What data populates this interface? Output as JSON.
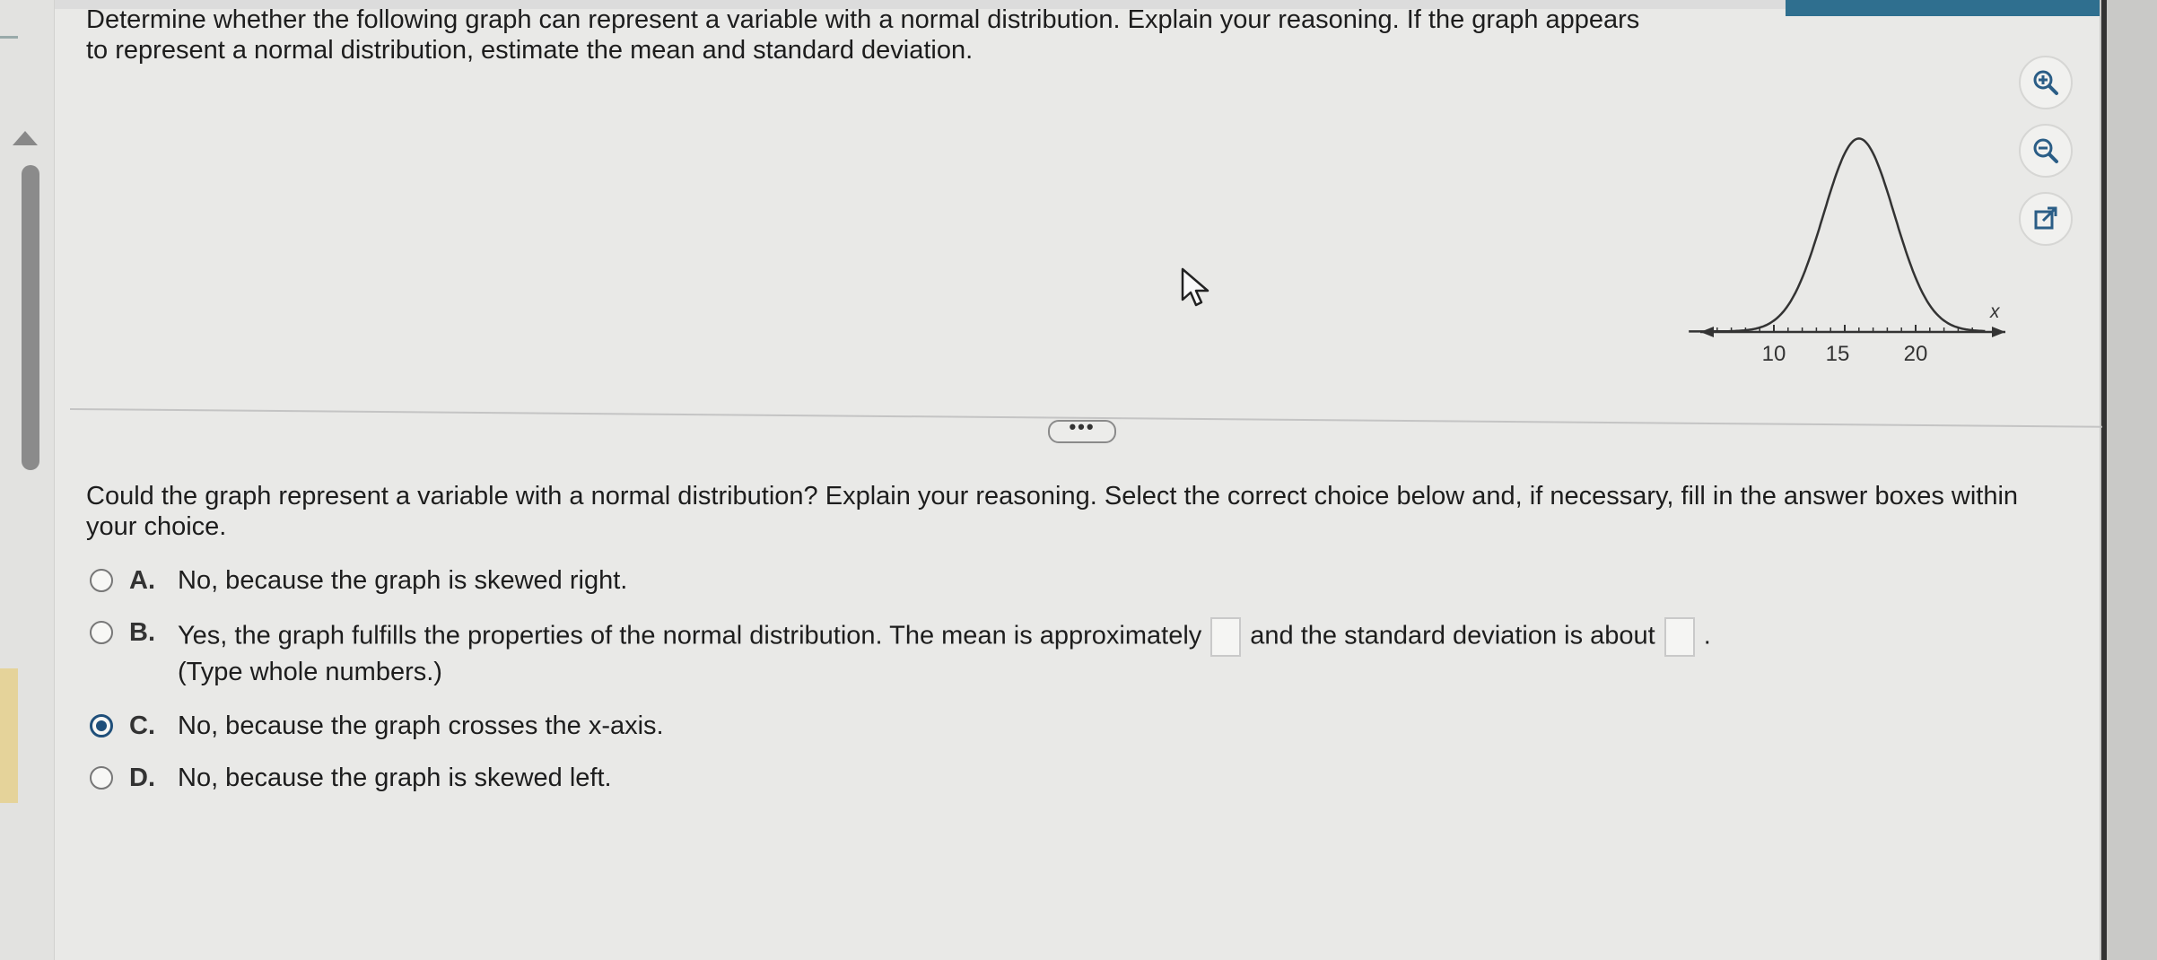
{
  "question": {
    "text": "Determine whether the following graph can represent a variable with a normal distribution. Explain your reasoning. If the graph appears to represent a normal distribution, estimate the mean and standard deviation."
  },
  "graph": {
    "x_ticks": [
      "10",
      "15",
      "20"
    ],
    "axis_label": "x"
  },
  "chart_data": {
    "type": "line",
    "x_range": [
      4,
      25
    ],
    "peak_x": 16,
    "tick_values": [
      10,
      15,
      20
    ],
    "axis_label": "x"
  },
  "graph_tools": {
    "zoom_in": "zoom-in-icon",
    "zoom_out": "zoom-out-icon",
    "popout": "external-link-icon"
  },
  "divider": {
    "more_label": "•••"
  },
  "sub_question": {
    "text": "Could the graph represent a variable with a normal distribution? Explain your reasoning. Select the correct choice below and, if necessary, fill in the answer boxes within your choice."
  },
  "choices": [
    {
      "letter": "A.",
      "text": "No, because the graph is skewed right.",
      "selected": false
    },
    {
      "letter": "B.",
      "text_before": "Yes, the graph fulfills the properties of the normal distribution. The mean is approximately",
      "text_middle": "and the standard deviation is about",
      "text_after": ".",
      "hint": "(Type whole numbers.)",
      "selected": false
    },
    {
      "letter": "C.",
      "text": "No, because the graph crosses the x-axis.",
      "selected": true
    },
    {
      "letter": "D.",
      "text": "No, because the graph is skewed left.",
      "selected": false
    }
  ],
  "colors": {
    "accent": "#1f4f7a",
    "page_bg": "#e9e9e7"
  }
}
